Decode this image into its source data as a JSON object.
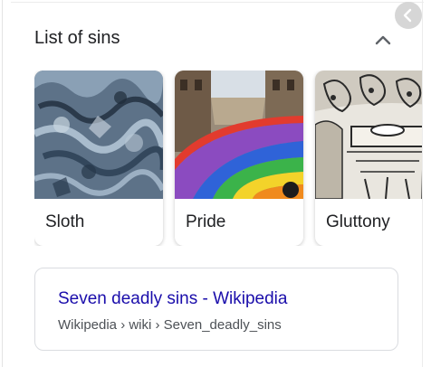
{
  "section": {
    "title": "List of sins",
    "collapse_icon": "chevron-up-icon"
  },
  "carousel": {
    "items": [
      {
        "label": "Sloth"
      },
      {
        "label": "Pride"
      },
      {
        "label": "Gluttony"
      }
    ]
  },
  "result": {
    "title": "Seven deadly sins - Wikipedia",
    "url": "Wikipedia › wiki › Seven_deadly_sins"
  },
  "colors": {
    "link": "#1a0dab",
    "text": "#202124",
    "url": "#4d5156",
    "border": "#dadce0"
  }
}
